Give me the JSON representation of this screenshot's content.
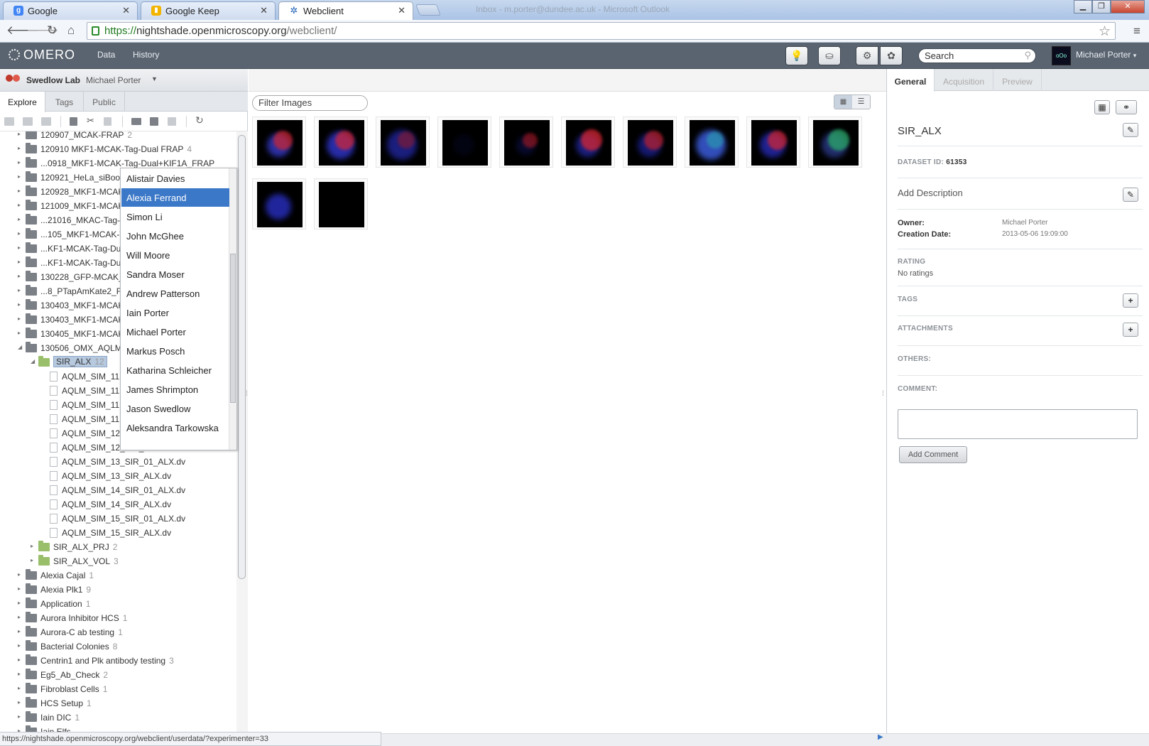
{
  "browser": {
    "tabs": [
      {
        "title": "Google",
        "favicon": "google-icon"
      },
      {
        "title": "Google Keep",
        "favicon": "keep-icon"
      },
      {
        "title": "Webclient",
        "favicon": "omero-icon"
      }
    ],
    "window_title": "Inbox - m.porter@dundee.ac.uk - Microsoft Outlook",
    "url_scheme": "https://",
    "url_host": "nightshade.openmicroscopy.org",
    "url_path": "/webclient/"
  },
  "header": {
    "logo": "OMERO",
    "nav": [
      "Data",
      "History"
    ],
    "search_placeholder": "Search",
    "user_name": "Michael Porter",
    "avatar_text": "oOo"
  },
  "left": {
    "group_name": "Swedlow Lab",
    "group_user": "Michael Porter",
    "tabs": [
      "Explore",
      "Tags",
      "Public"
    ],
    "tree": [
      {
        "label": "120907_MCAK-FRAP",
        "count": "2",
        "level": 1,
        "kind": "folder"
      },
      {
        "label": "120910 MKF1-MCAK-Tag-Dual FRAP",
        "count": "4",
        "level": 1,
        "kind": "folder"
      },
      {
        "label": "...0918_MKF1-MCAK-Tag-Dual+KIF1A_FRAP",
        "count": "",
        "level": 1,
        "kind": "folder"
      },
      {
        "label": "120921_HeLa_siBoost",
        "count": "",
        "level": 1,
        "kind": "folder"
      },
      {
        "label": "120928_MKF1-MCAK",
        "count": "",
        "level": 1,
        "kind": "folder"
      },
      {
        "label": "121009_MKF1-MCAK",
        "count": "",
        "level": 1,
        "kind": "folder"
      },
      {
        "label": "...21016_MKAC-Tag-",
        "count": "",
        "level": 1,
        "kind": "folder"
      },
      {
        "label": "...105_MKF1-MCAK-T",
        "count": "",
        "level": 1,
        "kind": "folder"
      },
      {
        "label": "...KF1-MCAK-Tag-Du",
        "count": "",
        "level": 1,
        "kind": "folder"
      },
      {
        "label": "...KF1-MCAK-Tag-Du",
        "count": "",
        "level": 1,
        "kind": "folder"
      },
      {
        "label": "130228_GFP-MCAK_",
        "count": "",
        "level": 1,
        "kind": "folder"
      },
      {
        "label": "...8_PTapAmKate2_F",
        "count": "",
        "level": 1,
        "kind": "folder"
      },
      {
        "label": "130403_MKF1-MCAK",
        "count": "",
        "level": 1,
        "kind": "folder"
      },
      {
        "label": "130403_MKF1-MCAK",
        "count": "",
        "level": 1,
        "kind": "folder"
      },
      {
        "label": "130405_MKF1-MCAK",
        "count": "",
        "level": 1,
        "kind": "folder"
      },
      {
        "label": "130506_OMX_AQLM",
        "count": "",
        "level": 1,
        "kind": "folder-open"
      },
      {
        "label": "SIR_ALX",
        "count": "12",
        "level": 2,
        "kind": "dataset-selected"
      },
      {
        "label": "AQLM_SIM_11",
        "count": "",
        "level": 3,
        "kind": "image"
      },
      {
        "label": "AQLM_SIM_11",
        "count": "",
        "level": 3,
        "kind": "image"
      },
      {
        "label": "AQLM_SIM_11",
        "count": "",
        "level": 3,
        "kind": "image"
      },
      {
        "label": "AQLM_SIM_11",
        "count": "",
        "level": 3,
        "kind": "image"
      },
      {
        "label": "AQLM_SIM_12",
        "count": "",
        "level": 3,
        "kind": "image"
      },
      {
        "label": "AQLM_SIM_12_SIR_ALX.dv",
        "count": "",
        "level": 3,
        "kind": "image"
      },
      {
        "label": "AQLM_SIM_13_SIR_01_ALX.dv",
        "count": "",
        "level": 3,
        "kind": "image"
      },
      {
        "label": "AQLM_SIM_13_SIR_ALX.dv",
        "count": "",
        "level": 3,
        "kind": "image"
      },
      {
        "label": "AQLM_SIM_14_SIR_01_ALX.dv",
        "count": "",
        "level": 3,
        "kind": "image"
      },
      {
        "label": "AQLM_SIM_14_SIR_ALX.dv",
        "count": "",
        "level": 3,
        "kind": "image"
      },
      {
        "label": "AQLM_SIM_15_SIR_01_ALX.dv",
        "count": "",
        "level": 3,
        "kind": "image"
      },
      {
        "label": "AQLM_SIM_15_SIR_ALX.dv",
        "count": "",
        "level": 3,
        "kind": "image"
      },
      {
        "label": "SIR_ALX_PRJ",
        "count": "2",
        "level": 2,
        "kind": "dataset"
      },
      {
        "label": "SIR_ALX_VOL",
        "count": "3",
        "level": 2,
        "kind": "dataset"
      },
      {
        "label": "Alexia Cajal",
        "count": "1",
        "level": 1,
        "kind": "folder"
      },
      {
        "label": "Alexia Plk1",
        "count": "9",
        "level": 1,
        "kind": "folder"
      },
      {
        "label": "Application",
        "count": "1",
        "level": 1,
        "kind": "folder"
      },
      {
        "label": "Aurora Inhibitor HCS",
        "count": "1",
        "level": 1,
        "kind": "folder"
      },
      {
        "label": "Aurora-C ab testing",
        "count": "1",
        "level": 1,
        "kind": "folder"
      },
      {
        "label": "Bacterial Colonies",
        "count": "8",
        "level": 1,
        "kind": "folder"
      },
      {
        "label": "Centrin1 and Plk antibody testing",
        "count": "3",
        "level": 1,
        "kind": "folder"
      },
      {
        "label": "Eg5_Ab_Check",
        "count": "2",
        "level": 1,
        "kind": "folder"
      },
      {
        "label": "Fibroblast Cells",
        "count": "1",
        "level": 1,
        "kind": "folder"
      },
      {
        "label": "HCS Setup",
        "count": "1",
        "level": 1,
        "kind": "folder"
      },
      {
        "label": "Iain DIC",
        "count": "1",
        "level": 1,
        "kind": "folder"
      },
      {
        "label": "Iain Elfs",
        "count": "",
        "level": 1,
        "kind": "folder"
      }
    ]
  },
  "dropdown": {
    "items": [
      "Alistair Davies",
      "Alexia Ferrand",
      "Simon Li",
      "John McGhee",
      "Will Moore",
      "Sandra Moser",
      "Andrew Patterson",
      "Iain Porter",
      "Michael Porter",
      "Markus Posch",
      "Katharina Schleicher",
      "James Shrimpton",
      "Jason Swedlow",
      "Aleksandra Tarkowska"
    ],
    "highlighted": "Alexia Ferrand"
  },
  "centre": {
    "filter_placeholder": "Filter Images",
    "thumbnails": [
      {
        "blobs": [
          [
            "#3a3fd6",
            0.5
          ],
          [
            "#d9262b",
            0.3
          ]
        ]
      },
      {
        "blobs": [
          [
            "#2f35c9",
            0.7
          ],
          [
            "#e0262e",
            0.3
          ]
        ]
      },
      {
        "blobs": [
          [
            "#1e2390",
            0.8
          ],
          [
            "#8a1a2e",
            0.2
          ]
        ]
      },
      {
        "blobs": [
          [
            "#05061a",
            0.4
          ]
        ]
      },
      {
        "blobs": [
          [
            "#0c0f45",
            0.3
          ],
          [
            "#b01a22",
            0.1
          ]
        ]
      },
      {
        "blobs": [
          [
            "#242aa8",
            0.5
          ],
          [
            "#e0262e",
            0.4
          ]
        ]
      },
      {
        "blobs": [
          [
            "#1c2296",
            0.5
          ],
          [
            "#c7222b",
            0.3
          ]
        ]
      },
      {
        "blobs": [
          [
            "#3a5ad6",
            0.8
          ],
          [
            "#2aa0b0",
            0.2
          ]
        ]
      },
      {
        "blobs": [
          [
            "#272cb8",
            0.6
          ],
          [
            "#e0262e",
            0.3
          ]
        ]
      },
      {
        "blobs": [
          [
            "#2b3a8a",
            0.6
          ],
          [
            "#2bb06a",
            0.4
          ]
        ]
      },
      {
        "blobs": [
          [
            "#2a30c6",
            0.6
          ]
        ]
      },
      {
        "blobs": []
      }
    ]
  },
  "right": {
    "tabs": [
      "General",
      "Acquisition",
      "Preview"
    ],
    "title": "SIR_ALX",
    "dataset_id_label": "DATASET ID:",
    "dataset_id": "61353",
    "add_description": "Add Description",
    "owner_label": "Owner:",
    "owner": "Michael Porter",
    "creation_label": "Creation Date:",
    "creation_date": "2013-05-06 19:09:00",
    "rating_label": "RATING",
    "rating_value": "No ratings",
    "tags_label": "TAGS",
    "attachments_label": "ATTACHMENTS",
    "others_label": "OTHERS:",
    "comment_label": "COMMENT:",
    "add_comment": "Add Comment"
  },
  "status_url": "https://nightshade.openmicroscopy.org/webclient/userdata/?experimenter=33"
}
